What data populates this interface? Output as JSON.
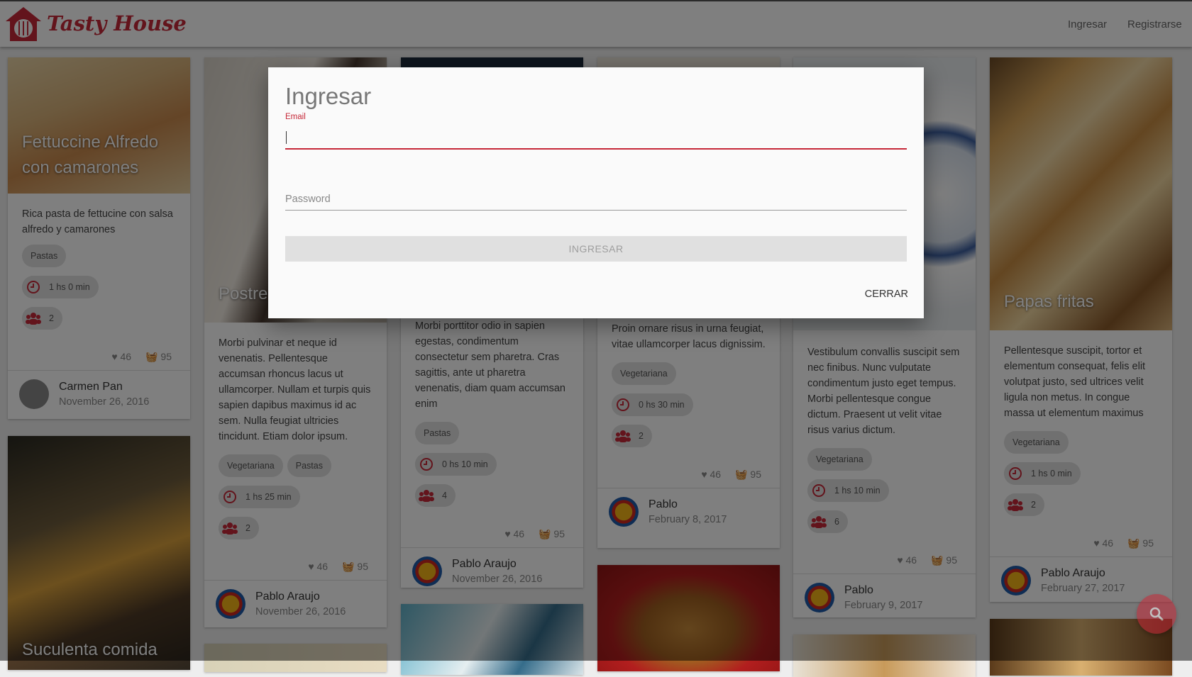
{
  "header": {
    "brand": "Tasty House",
    "login": "Ingresar",
    "register": "Registrarse"
  },
  "colors": {
    "accent": "#c62838",
    "chip": "#e0e0e0"
  },
  "cards": [
    {
      "title": "Fettuccine Alfredo con camarones",
      "desc": "Rica pasta de fettucine con salsa alfredo y camarones",
      "tags": [
        "Pastas"
      ],
      "time": "1 hs 0 min",
      "people": "2",
      "likes": "46",
      "baskets": "95",
      "author": "Carmen Pan",
      "date": "November 26, 2016"
    },
    {
      "title": "Postre",
      "desc": "Morbi pulvinar et neque id venenatis. Pellentesque accumsan rhoncus lacus ut ullamcorper. Nullam et turpis quis sapien dapibus maximus id ac sem. Nulla feugiat ultricies tincidunt. Etiam dolor ipsum.",
      "tags": [
        "Vegetariana",
        "Pastas"
      ],
      "time": "1 hs 25 min",
      "people": "2",
      "likes": "46",
      "baskets": "95",
      "author": "Pablo Araujo",
      "date": "November 26, 2016"
    },
    {
      "title": "",
      "desc": "Morbi porttitor odio in sapien egestas, condimentum consectetur sem pharetra. Cras sagittis, ante ut pharetra venenatis, diam quam accumsan enim",
      "tags": [
        "Pastas"
      ],
      "time": "0 hs 10 min",
      "people": "4",
      "likes": "46",
      "baskets": "95",
      "author": "Pablo Araujo",
      "date": "November 26, 2016"
    },
    {
      "title": "",
      "desc": "Proin ornare risus in urna feugiat, vitae ullamcorper lacus dignissim.",
      "tags": [
        "Vegetariana"
      ],
      "time": "0 hs 30 min",
      "people": "2",
      "likes": "46",
      "baskets": "95",
      "author": "Pablo",
      "date": "February 8, 2017"
    },
    {
      "title": "",
      "desc": "Vestibulum convallis suscipit sem nec finibus. Nunc vulputate condimentum justo eget tempus. Morbi pellentesque congue dictum. Praesent ut velit vitae risus varius dictum.",
      "tags": [
        "Vegetariana"
      ],
      "time": "1 hs 10 min",
      "people": "6",
      "likes": "46",
      "baskets": "95",
      "author": "Pablo",
      "date": "February 9, 2017"
    },
    {
      "title": "Papas fritas",
      "desc": "Pellentesque suscipit, tortor et elementum consequat, felis elit volutpat justo, sed ultrices velit ligula non metus. In congue massa ut elementum maximus",
      "tags": [
        "Vegetariana"
      ],
      "time": "1 hs 0 min",
      "people": "2",
      "likes": "46",
      "baskets": "95",
      "author": "Pablo Araujo",
      "date": "February 27, 2017"
    }
  ],
  "bottom_cards": [
    {
      "title": "Suculenta comida"
    }
  ],
  "dialog": {
    "title": "Ingresar",
    "email_label": "Email",
    "email_value": "",
    "password_placeholder": "Password",
    "submit": "INGRESAR",
    "close": "CERRAR"
  }
}
